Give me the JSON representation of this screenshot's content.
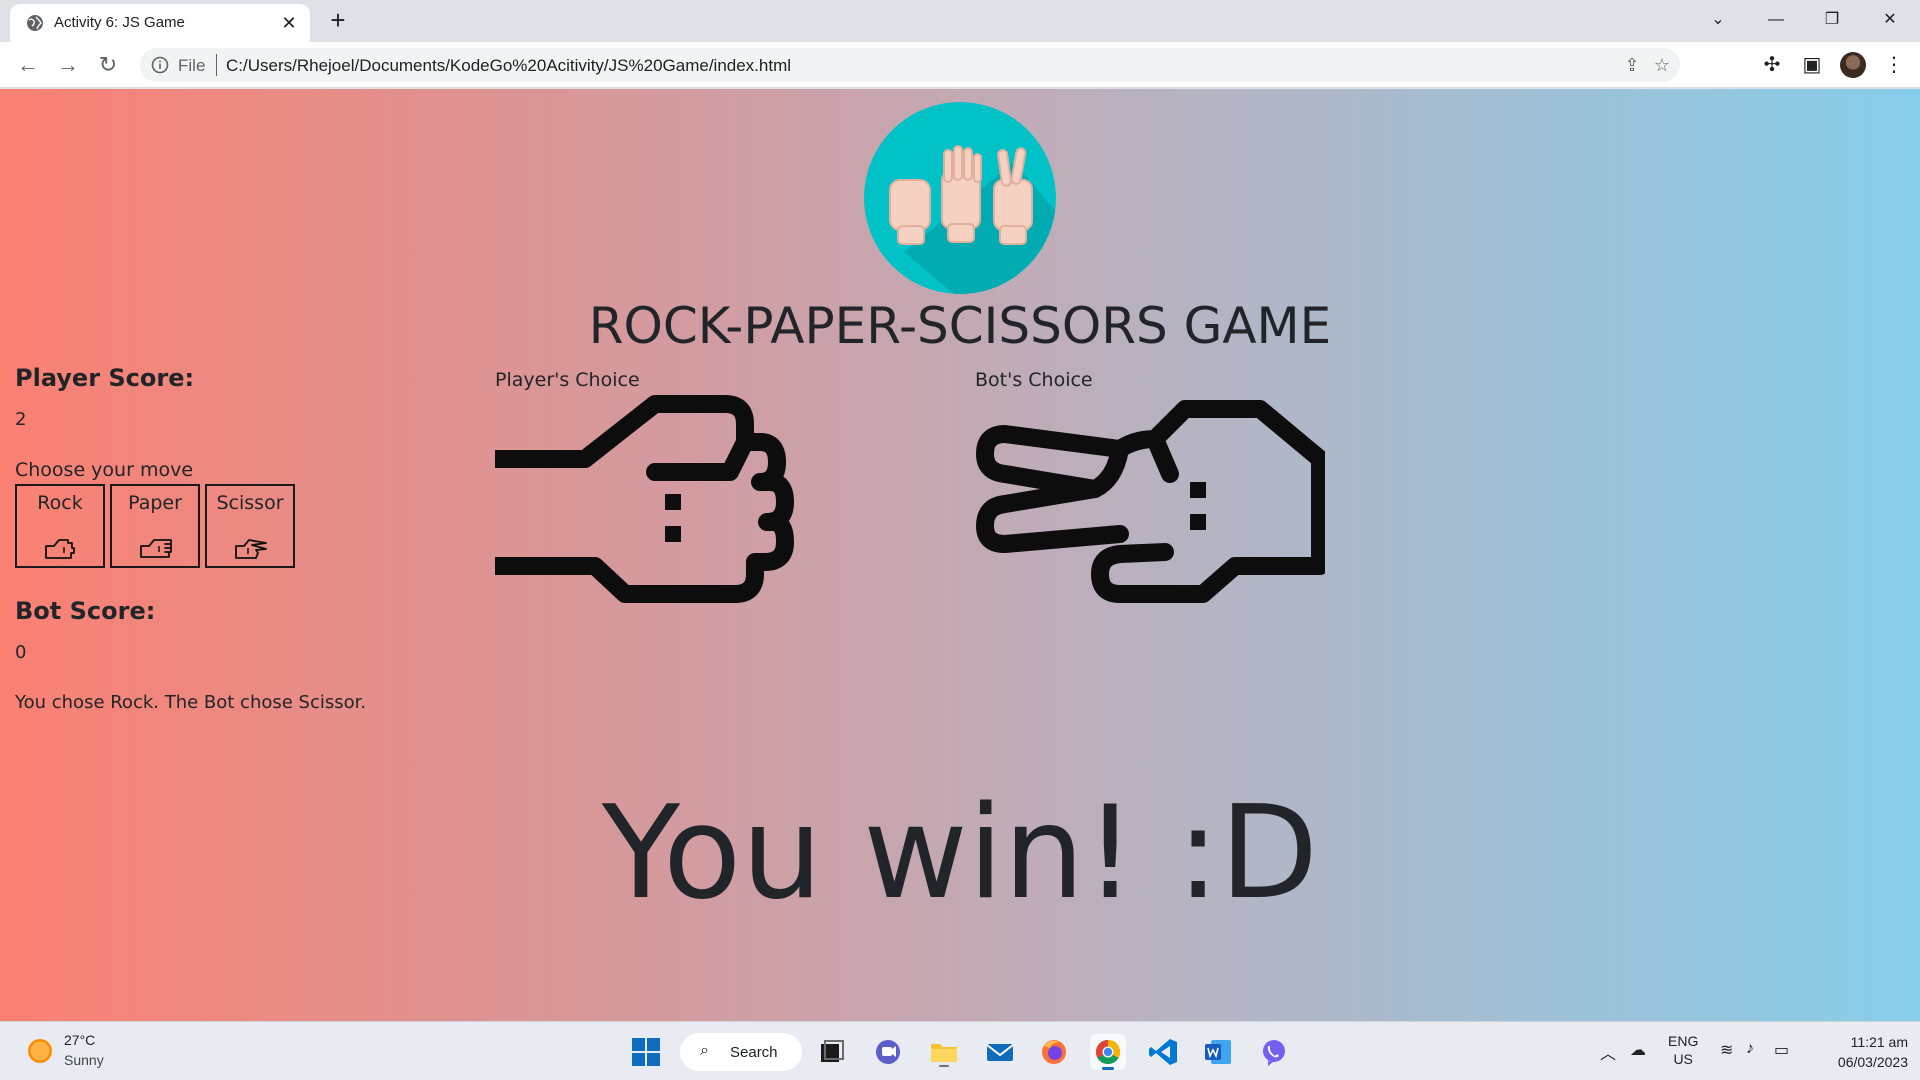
{
  "browser": {
    "tab_title": "Activity 6: JS Game",
    "new_tab_glyph": "+",
    "file_label": "File",
    "url": "C:/Users/Rhejoel/Documents/KodeGo%20Acitivity/JS%20Game/index.html"
  },
  "game": {
    "title": "ROCK-PAPER-SCISSORS GAME",
    "player_score_label": "Player Score:",
    "player_score": "2",
    "choose_label": "Choose your move",
    "moves": [
      {
        "label": "Rock",
        "icon": "rock-hand-icon"
      },
      {
        "label": "Paper",
        "icon": "paper-hand-icon"
      },
      {
        "label": "Scissor",
        "icon": "scissor-hand-icon"
      }
    ],
    "bot_score_label": "Bot Score:",
    "bot_score": "0",
    "result_message": "You chose Rock. The Bot chose Scissor.",
    "player_choice_label": "Player's Choice",
    "bot_choice_label": "Bot's Choice",
    "player_choice_icon": "rock-hand-icon",
    "bot_choice_icon": "scissor-hand-icon",
    "outcome": "You win! :D"
  },
  "taskbar": {
    "temperature": "27°C",
    "condition": "Sunny",
    "search_label": "Search",
    "lang_top": "ENG",
    "lang_bottom": "US",
    "time": "11:21 am",
    "date": "06/03/2023"
  },
  "colors": {
    "gradient_left": "#fa8072",
    "gradient_right": "#87ceeb",
    "logo_bg": "#00c2c7",
    "text": "#212529"
  }
}
